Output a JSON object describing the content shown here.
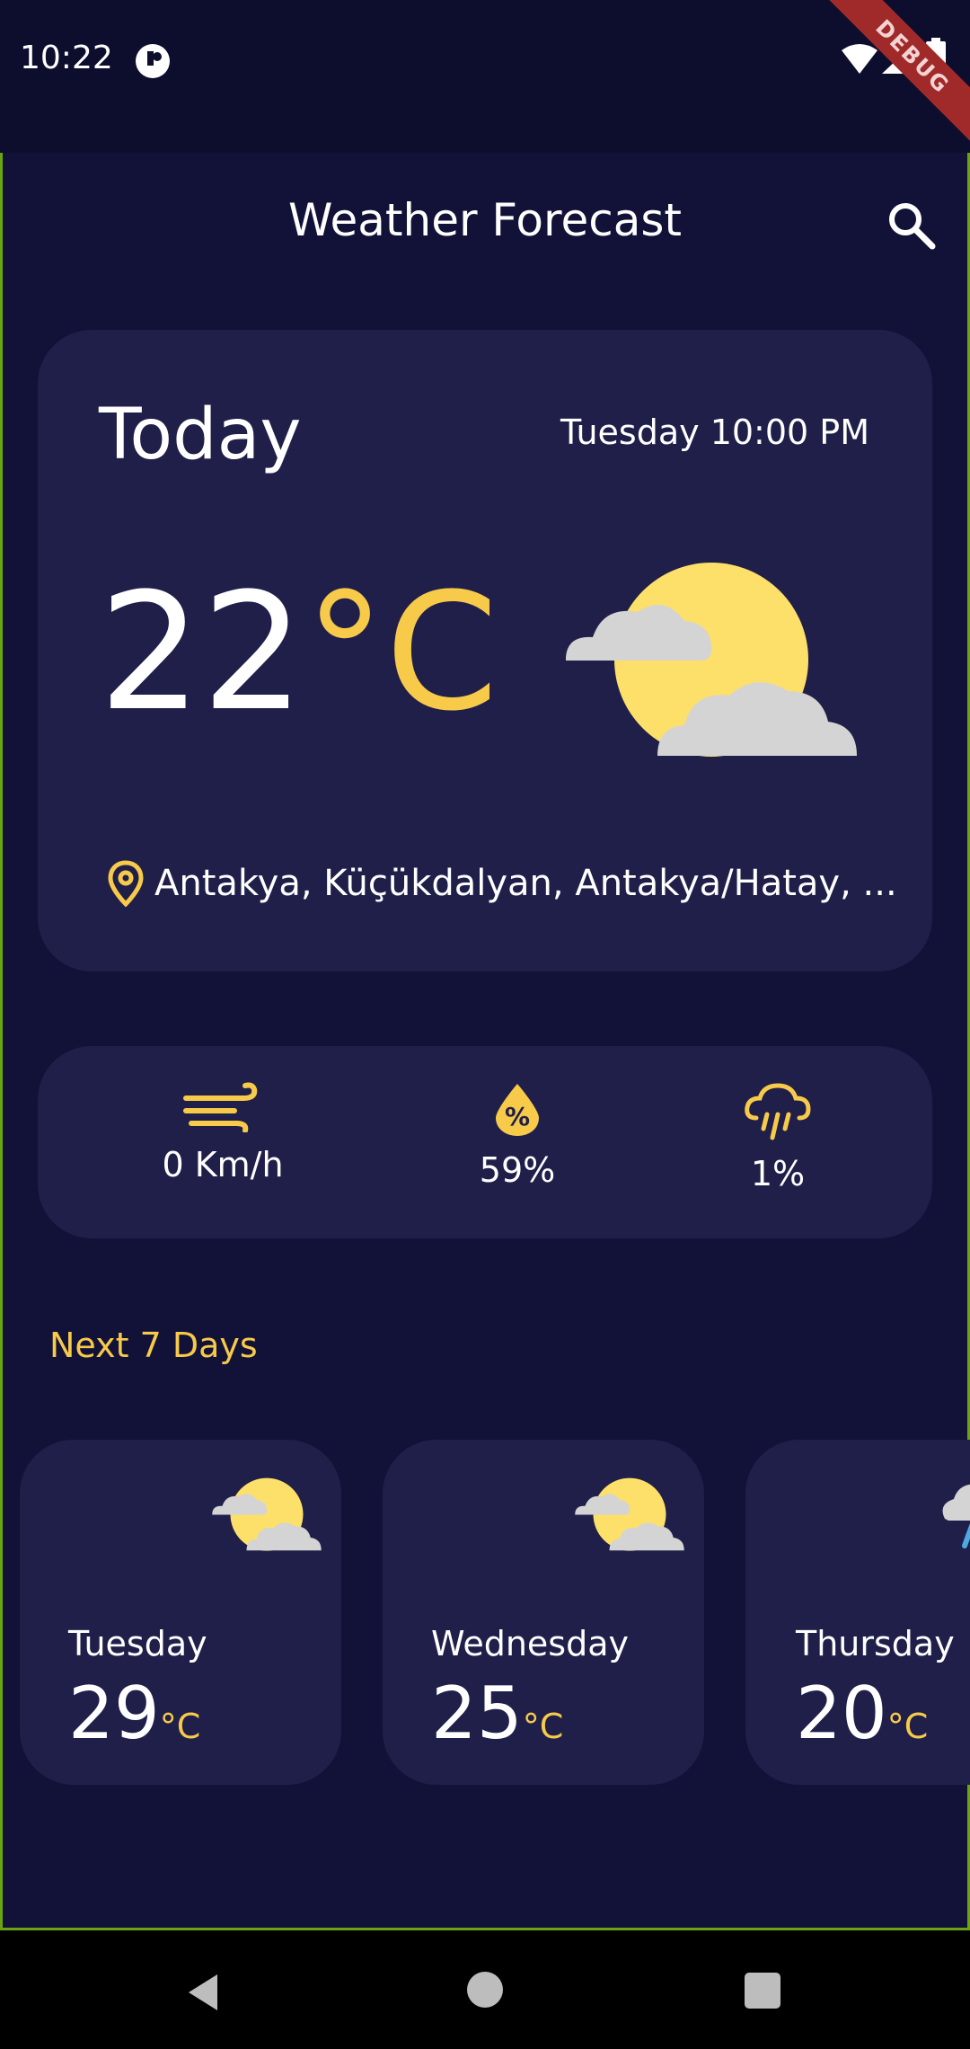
{
  "status_bar": {
    "time": "10:22",
    "debug_label": "DEBUG"
  },
  "app_bar": {
    "title": "Weather Forecast",
    "search_icon": "search-icon"
  },
  "today": {
    "label": "Today",
    "datetime": "Tuesday 10:00 PM",
    "temperature": "22",
    "unit": "°C",
    "condition_icon": "sun-behind-clouds-icon",
    "location": "Antakya, Küçükdalyan, Antakya/Hatay, ..."
  },
  "stats": [
    {
      "icon": "wind-icon",
      "value": "0 Km/h"
    },
    {
      "icon": "humidity-icon",
      "value": "59%"
    },
    {
      "icon": "rain-cloud-icon",
      "value": "1%"
    }
  ],
  "next_days_title": "Next 7 Days",
  "forecast": [
    {
      "day": "Tuesday",
      "temp": "29",
      "unit": "°C",
      "icon": "sun-behind-clouds-icon"
    },
    {
      "day": "Wednesday",
      "temp": "25",
      "unit": "°C",
      "icon": "sun-behind-clouds-icon"
    },
    {
      "day": "Thursday",
      "temp": "20",
      "unit": "°C",
      "icon": "rain-icon"
    }
  ],
  "colors": {
    "background": "#121238",
    "card": "#1f1f4a",
    "accent": "#f8ca4a",
    "cloud": "#d4d4d4"
  }
}
